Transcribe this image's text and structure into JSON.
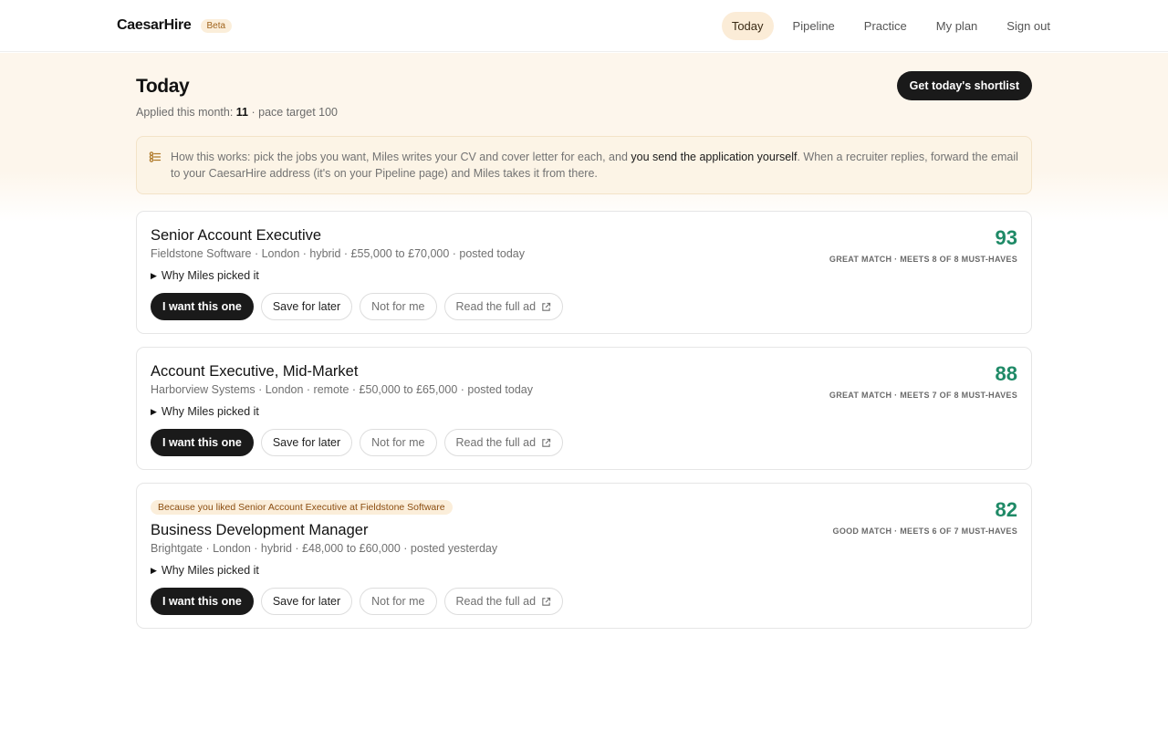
{
  "brand": {
    "name": "CaesarHire",
    "badge": "Beta"
  },
  "nav": [
    {
      "label": "Today",
      "active": true
    },
    {
      "label": "Pipeline",
      "active": false
    },
    {
      "label": "Practice",
      "active": false
    },
    {
      "label": "My plan",
      "active": false
    },
    {
      "label": "Sign out",
      "active": false
    }
  ],
  "page": {
    "title": "Today",
    "applied_prefix": "Applied this month:",
    "applied_count": "11",
    "pace_text": "· pace target 100",
    "shortlist_button": "Get today's shortlist"
  },
  "info": {
    "part1": "How this works: pick the jobs you want, Miles writes your CV and cover letter for each, and ",
    "highlight": "you send the application yourself",
    "part2": ". When a recruiter replies, forward the email to your CaesarHire address (it's on your Pipeline page) and Miles takes it from there."
  },
  "labels": {
    "why": "Why Miles picked it",
    "want": "I want this one",
    "save": "Save for later",
    "not": "Not for me",
    "read": "Read the full ad"
  },
  "jobs": [
    {
      "title": "Senior Account Executive",
      "meta": "Fieldstone Software · London · hybrid · £55,000 to £70,000 · posted today",
      "score": "93",
      "match": "GREAT MATCH · MEETS 8 OF 8 MUST-HAVES",
      "reason": ""
    },
    {
      "title": "Account Executive, Mid-Market",
      "meta": "Harborview Systems · London · remote · £50,000 to £65,000 · posted today",
      "score": "88",
      "match": "GREAT MATCH · MEETS 7 OF 8 MUST-HAVES",
      "reason": ""
    },
    {
      "title": "Business Development Manager",
      "meta": "Brightgate · London · hybrid · £48,000 to £60,000 · posted yesterday",
      "score": "82",
      "match": "GOOD MATCH · MEETS 6 OF 7 MUST-HAVES",
      "reason": "Because you liked Senior Account Executive at Fieldstone Software"
    }
  ],
  "colors": {
    "accent_green": "#1f8a67",
    "dark": "#1a1a1a",
    "cream": "#fdf6ec"
  },
  "icons": {
    "info": "sparkle-list-icon",
    "external": "external-link-icon"
  }
}
